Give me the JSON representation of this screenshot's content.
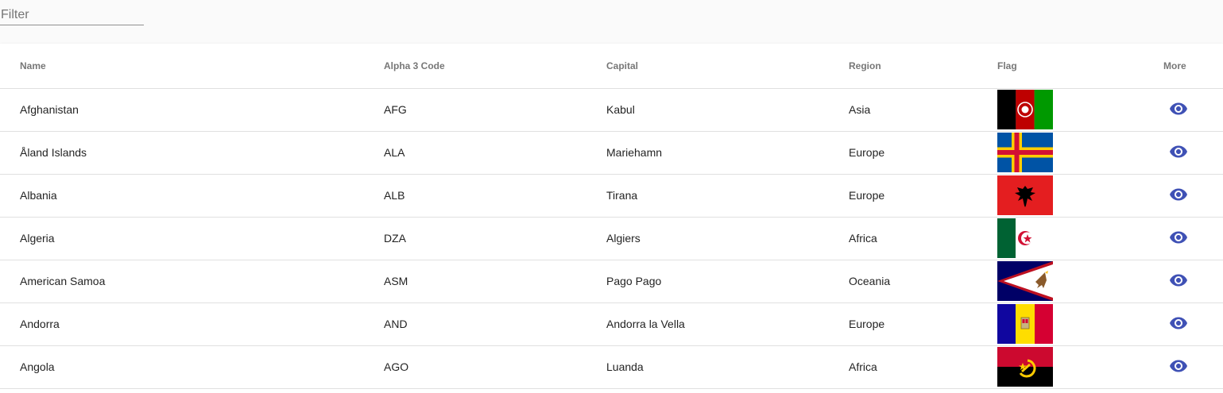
{
  "filter": {
    "placeholder": "Filter",
    "value": ""
  },
  "table": {
    "headers": {
      "name": "Name",
      "code": "Alpha 3 Code",
      "capital": "Capital",
      "region": "Region",
      "flag": "Flag",
      "more": "More"
    },
    "rows": [
      {
        "name": "Afghanistan",
        "code": "AFG",
        "capital": "Kabul",
        "region": "Asia"
      },
      {
        "name": "Åland Islands",
        "code": "ALA",
        "capital": "Mariehamn",
        "region": "Europe"
      },
      {
        "name": "Albania",
        "code": "ALB",
        "capital": "Tirana",
        "region": "Europe"
      },
      {
        "name": "Algeria",
        "code": "DZA",
        "capital": "Algiers",
        "region": "Africa"
      },
      {
        "name": "American Samoa",
        "code": "ASM",
        "capital": "Pago Pago",
        "region": "Oceania"
      },
      {
        "name": "Andorra",
        "code": "AND",
        "capital": "Andorra la Vella",
        "region": "Europe"
      },
      {
        "name": "Angola",
        "code": "AGO",
        "capital": "Luanda",
        "region": "Africa"
      }
    ]
  },
  "icons": {
    "more": "eye-icon"
  },
  "colors": {
    "accent": "#3f51b5"
  }
}
